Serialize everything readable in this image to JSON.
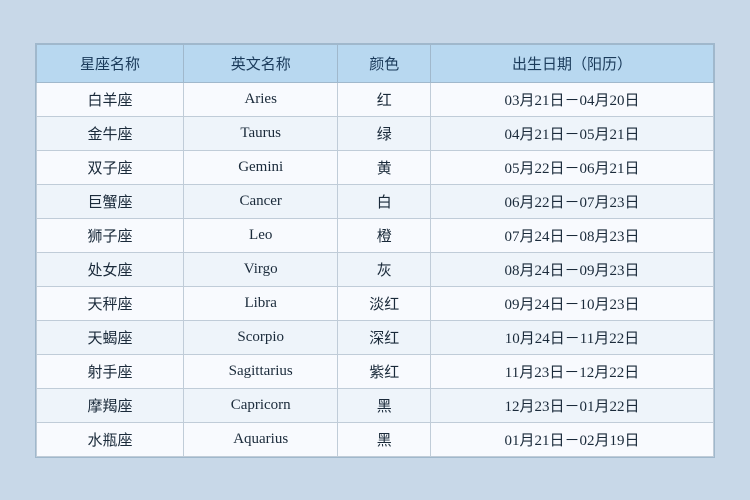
{
  "table": {
    "headers": [
      "星座名称",
      "英文名称",
      "颜色",
      "出生日期（阳历）"
    ],
    "rows": [
      {
        "cn": "白羊座",
        "en": "Aries",
        "color": "红",
        "date": "03月21日－04月20日"
      },
      {
        "cn": "金牛座",
        "en": "Taurus",
        "color": "绿",
        "date": "04月21日－05月21日"
      },
      {
        "cn": "双子座",
        "en": "Gemini",
        "color": "黄",
        "date": "05月22日－06月21日"
      },
      {
        "cn": "巨蟹座",
        "en": "Cancer",
        "color": "白",
        "date": "06月22日－07月23日"
      },
      {
        "cn": "狮子座",
        "en": "Leo",
        "color": "橙",
        "date": "07月24日－08月23日"
      },
      {
        "cn": "处女座",
        "en": "Virgo",
        "color": "灰",
        "date": "08月24日－09月23日"
      },
      {
        "cn": "天秤座",
        "en": "Libra",
        "color": "淡红",
        "date": "09月24日－10月23日"
      },
      {
        "cn": "天蝎座",
        "en": "Scorpio",
        "color": "深红",
        "date": "10月24日－11月22日"
      },
      {
        "cn": "射手座",
        "en": "Sagittarius",
        "color": "紫红",
        "date": "11月23日－12月22日"
      },
      {
        "cn": "摩羯座",
        "en": "Capricorn",
        "color": "黑",
        "date": "12月23日－01月22日"
      },
      {
        "cn": "水瓶座",
        "en": "Aquarius",
        "color": "黑",
        "date": "01月21日－02月19日"
      }
    ]
  }
}
